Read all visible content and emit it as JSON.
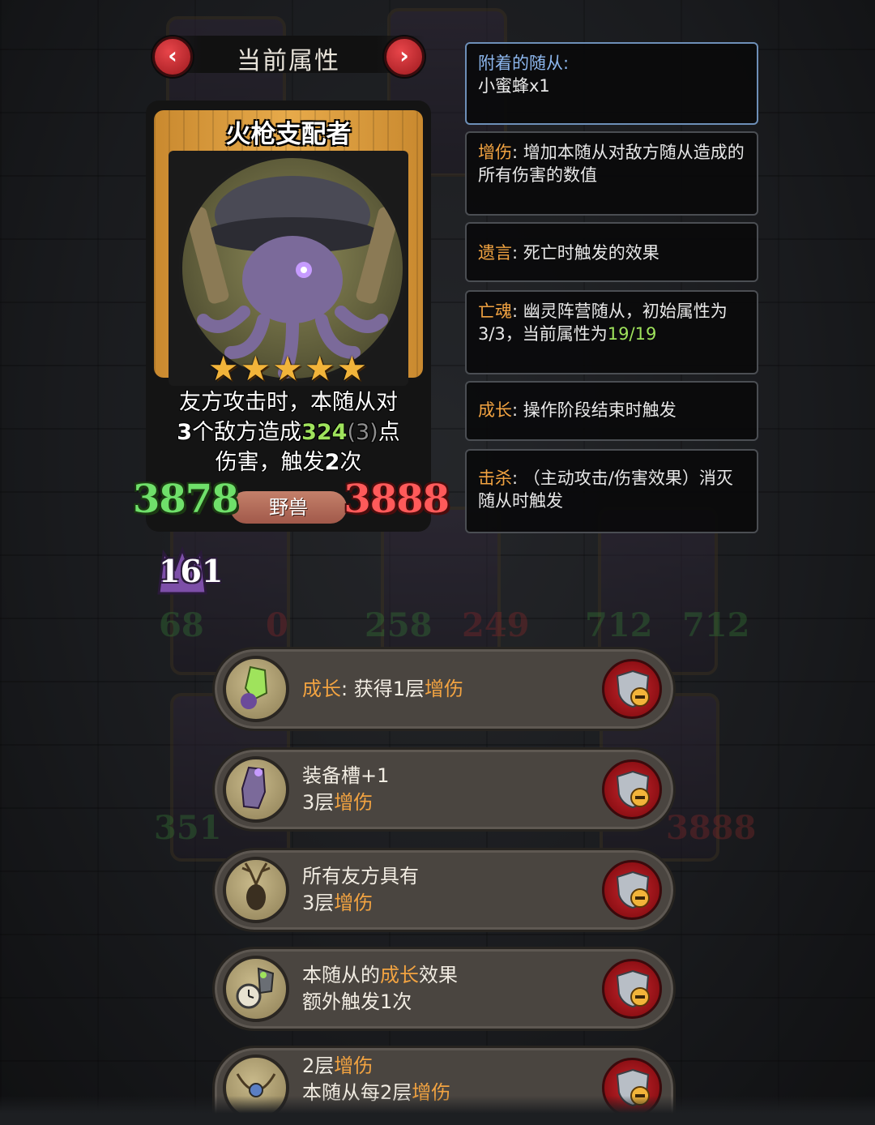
{
  "header": {
    "title": "当前属性",
    "prev_label": "‹",
    "next_label": "›"
  },
  "card": {
    "name": "火枪支配者",
    "stars": "★★★★★",
    "star_count": 5,
    "desc_line1": "友方攻击时，本随从对",
    "desc_line2_num": "3",
    "desc_line2_text": "个敌方造成",
    "desc_damage": "324",
    "desc_base": "(3)",
    "desc_line2_end": "点",
    "desc_line3_text": "伤害，触发",
    "desc_line3_num": "2",
    "desc_line3_end": "次",
    "attack": "3878",
    "health": "3888",
    "tribe": "野兽",
    "level": "161"
  },
  "info_panels": [
    {
      "title": "附着的随从:",
      "text": "小蜜蜂x1"
    },
    {
      "keyword": "增伤",
      "text": ": 增加本随从对敌方随从造成的所有伤害的数值"
    },
    {
      "keyword": "遗言",
      "text": ": 死亡时触发的效果"
    },
    {
      "keyword": "亡魂",
      "text_a": ": 幽灵阵营随从，初始属性为3/3，当前属性为",
      "text_green": "19/19"
    },
    {
      "keyword": "成长",
      "text": ": 操作阶段结束时触发"
    },
    {
      "keyword": "击杀",
      "text": ": （主动攻击/伤害效果）消灭随从时触发"
    }
  ],
  "effects": [
    {
      "line1_kw": "成长",
      "line1_a": ": 获得1层",
      "line1_kw2": "增伤",
      "line2_a": "",
      "line2_kw": ""
    },
    {
      "line1_kw": "",
      "line1_a": "装备槽+1",
      "line1_kw2": "",
      "line2_a": "3层",
      "line2_kw": "增伤"
    },
    {
      "line1_kw": "",
      "line1_a": "所有友方具有",
      "line1_kw2": "",
      "line2_a": "3层",
      "line2_kw": "增伤"
    },
    {
      "line1_kw": "",
      "line1_a": "本随从的",
      "line1_kw2": "成长",
      "line1_b": "效果",
      "line2_a": "额外触发1次",
      "line2_kw": ""
    },
    {
      "line1_kw": "",
      "line1_a": "2层",
      "line1_kw2": "增伤",
      "line2_a": "本随从每2层",
      "line2_kw": "增伤"
    }
  ],
  "background_numbers": [
    "68",
    "0",
    "258",
    "249",
    "712",
    "712",
    "351",
    "3888"
  ],
  "colors": {
    "keyword": "#f2a341",
    "attack": "#6fe06a",
    "health": "#ff5a5a",
    "highlight_green": "#9fe35c",
    "panel_border_active": "#6d8fb8"
  }
}
